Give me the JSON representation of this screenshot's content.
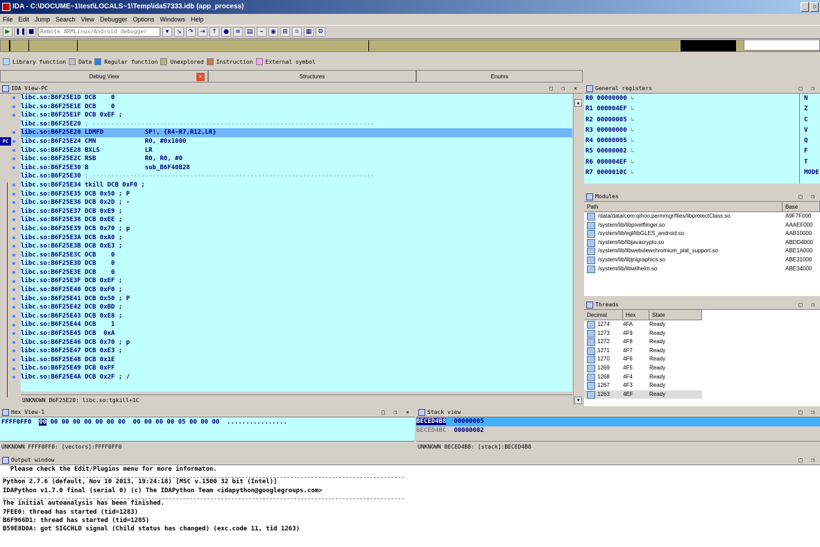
{
  "window": {
    "title": "IDA - C:\\DOCUME~1\\test\\LOCALS~1\\Temp\\ida57333.idb (app_process)"
  },
  "menu": [
    "File",
    "Edit",
    "Jump",
    "Search",
    "View",
    "Debugger",
    "Options",
    "Windows",
    "Help"
  ],
  "toolbar": {
    "debugger_select": "Remote ARMLinux/Android debugger"
  },
  "legend": [
    "Library function",
    "Data",
    "Regular function",
    "Unexplored",
    "Instruction",
    "External symbol"
  ],
  "legend_colors": {
    "library": "#a6e0ff",
    "data": "#c0c0c0",
    "regular": "#2080ff",
    "unexplored": "#b9b077",
    "instruction": "#c87850",
    "external": "#ffa0ff"
  },
  "tabs": {
    "debug_view": "Debug View",
    "structures": "Structures",
    "enums": "Enums"
  },
  "ida_view": {
    "title": "IDA View-PC",
    "pc_label": "PC",
    "lines": [
      {
        "addr": "libc.so:B6F25E1D",
        "code": " DCB    0"
      },
      {
        "addr": "libc.so:B6F25E1E",
        "code": " DCB    0"
      },
      {
        "addr": "libc.so:B6F25E1F",
        "code": " DCB 0xEF ;"
      },
      {
        "addr": "libc.so:B6F25E20",
        "code": " ; ---------------------------------------------------------------------------"
      },
      {
        "addr": "libc.so:B6F25E20",
        "code": " LDMFD           SP!, {R4-R7,R12,LR}"
      },
      {
        "addr": "libc.so:B6F25E24",
        "code": " CMN             R0, #0x1000"
      },
      {
        "addr": "libc.so:B6F25E28",
        "code": " BXLS            LR"
      },
      {
        "addr": "libc.so:B6F25E2C",
        "code": " RSB             R0, R0, #0"
      },
      {
        "addr": "libc.so:B6F25E30",
        "code": " B               sub_B6F40B28"
      },
      {
        "addr": "libc.so:B6F25E30",
        "code": " ; ---------------------------------------------------------------------------"
      },
      {
        "addr": "libc.so:B6F25E34",
        "code": " tkill DCB 0xF0 ;"
      },
      {
        "addr": "libc.so:B6F25E35",
        "code": " DCB 0x50 ; P"
      },
      {
        "addr": "libc.so:B6F25E36",
        "code": " DCB 0x2D ; -"
      },
      {
        "addr": "libc.so:B6F25E37",
        "code": " DCB 0xE9 ;"
      },
      {
        "addr": "libc.so:B6F25E38",
        "code": " DCB 0xEE ;"
      },
      {
        "addr": "libc.so:B6F25E39",
        "code": " DCB 0x70 ; p"
      },
      {
        "addr": "libc.so:B6F25E3A",
        "code": " DCB 0xA0 ;"
      },
      {
        "addr": "libc.so:B6F25E3B",
        "code": " DCB 0xE3 ;"
      },
      {
        "addr": "libc.so:B6F25E3C",
        "code": " DCB    0"
      },
      {
        "addr": "libc.so:B6F25E3D",
        "code": " DCB    0"
      },
      {
        "addr": "libc.so:B6F25E3E",
        "code": " DCB    0"
      },
      {
        "addr": "libc.so:B6F25E3F",
        "code": " DCB 0xEF ;"
      },
      {
        "addr": "libc.so:B6F25E40",
        "code": " DCB 0xF0 ;"
      },
      {
        "addr": "libc.so:B6F25E41",
        "code": " DCB 0x50 ; P"
      },
      {
        "addr": "libc.so:B6F25E42",
        "code": " DCB 0xBD ;"
      },
      {
        "addr": "libc.so:B6F25E43",
        "code": " DCB 0xE8 ;"
      },
      {
        "addr": "libc.so:B6F25E44",
        "code": " DCB    1"
      },
      {
        "addr": "libc.so:B6F25E45",
        "code": " DCB  0xA"
      },
      {
        "addr": "libc.so:B6F25E46",
        "code": " DCB 0x70 ; p"
      },
      {
        "addr": "libc.so:B6F25E47",
        "code": " DCB 0xE3 ;"
      },
      {
        "addr": "libc.so:B6F25E48",
        "code": " DCB 0x1E"
      },
      {
        "addr": "libc.so:B6F25E49",
        "code": " DCB 0xFF"
      },
      {
        "addr": "libc.so:B6F25E4A",
        "code": " DCB 0x2F ; /"
      }
    ],
    "status": "UNKNOWN B6F25E20: libc.so:tgkill+1C"
  },
  "registers": {
    "title": "General registers",
    "rows": [
      {
        "name": "R0",
        "value": "00000000"
      },
      {
        "name": "R1",
        "value": "000004EF"
      },
      {
        "name": "R2",
        "value": "00000005"
      },
      {
        "name": "R3",
        "value": "00000000"
      },
      {
        "name": "R4",
        "value": "00000005"
      },
      {
        "name": "R5",
        "value": "00000002"
      },
      {
        "name": "R6",
        "value": "000004EF"
      },
      {
        "name": "R7",
        "value": "0000010C"
      }
    ],
    "flags": [
      "N",
      "Z",
      "C",
      "V",
      "Q",
      "F",
      "T",
      "MODE"
    ]
  },
  "modules": {
    "title": "Modules",
    "columns": [
      "Path",
      "Base"
    ],
    "rows": [
      {
        "path": "/data/data/com.qihoo.permmgr/files/libprotectClass.so",
        "base": "A9F7F000"
      },
      {
        "path": "/system/lib/libpixelflinger.so",
        "base": "AAAEF000"
      },
      {
        "path": "/system/lib/egl/libGLES_android.so",
        "base": "AAB10000"
      },
      {
        "path": "/system/lib/libjavacrypto.so",
        "base": "ABDD4000"
      },
      {
        "path": "/system/lib/libwebviewchromium_plat_support.so",
        "base": "ABE1A000"
      },
      {
        "path": "/system/lib/libjnigraphics.so",
        "base": "ABE31000"
      },
      {
        "path": "/system/lib/libwilhelm.so",
        "base": "ABE34000"
      }
    ]
  },
  "threads": {
    "title": "Threads",
    "columns": [
      "Decimal",
      "Hex",
      "State"
    ],
    "rows": [
      {
        "dec": "1274",
        "hex": "4FA",
        "state": "Ready"
      },
      {
        "dec": "1273",
        "hex": "4F9",
        "state": "Ready"
      },
      {
        "dec": "1272",
        "hex": "4F8",
        "state": "Ready"
      },
      {
        "dec": "1271",
        "hex": "4F7",
        "state": "Ready"
      },
      {
        "dec": "1270",
        "hex": "4F6",
        "state": "Ready"
      },
      {
        "dec": "1269",
        "hex": "4F5",
        "state": "Ready"
      },
      {
        "dec": "1268",
        "hex": "4F4",
        "state": "Ready"
      },
      {
        "dec": "1267",
        "hex": "4F3",
        "state": "Ready"
      },
      {
        "dec": "1263",
        "hex": "4EF",
        "state": "Ready"
      }
    ]
  },
  "hex_view": {
    "title": "Hex View-1",
    "addr": "FFFF0FF0",
    "first_byte": "00",
    "bytes": " 00 00 00 00 00 00 00  00 00 00 00 05 00 00 00  ................",
    "status": "UNKNOWN FFFF0FF0: [vectors]:FFFF0FF0"
  },
  "stack_view": {
    "title": "Stack view",
    "rows": [
      {
        "addr": "BECED4B8",
        "value": "00000005"
      },
      {
        "addr": "BECED4BC",
        "value": "00000002"
      }
    ],
    "status": "UNKNOWN BECED4B8: [stack]:BECED4B8"
  },
  "output": {
    "title": "Output window",
    "lines": [
      "  Please check the Edit/Plugins menu for more informaton.",
      "---",
      "Python 2.7.6 (default, Nov 10 2013, 19:24:18) [MSC v.1500 32 bit (Intel)]",
      "IDAPython v1.7.0 final (serial 0) (c) The IDAPython Team <idapython@googlegroups.com>",
      "---",
      "The initial autoanalysis has been finished.",
      "7FEE0: thread has started (tid=1283)",
      "B6F966D1: thread has started (tid=1285)",
      "B59E8D0A: got SIGCHLD signal (Child status has changed) (exc.code 11, tid 1263)"
    ]
  }
}
